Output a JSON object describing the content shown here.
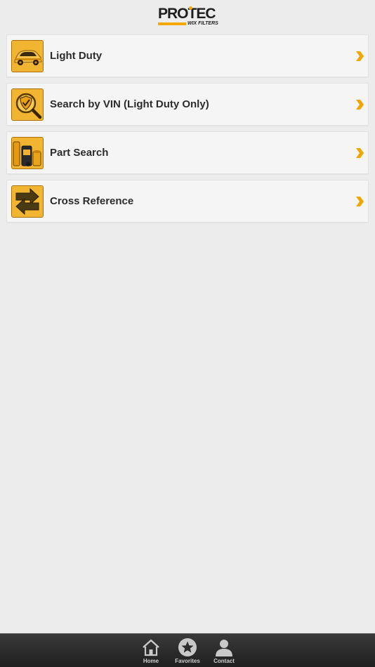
{
  "header": {
    "logo_main": "PROTEC",
    "logo_sub": "WIX FILTERS",
    "logo_accent": "#f5a800"
  },
  "menu": {
    "items": [
      {
        "label": "Light Duty",
        "icon": "car-icon"
      },
      {
        "label": "Search by VIN (Light Duty Only)",
        "icon": "shield-magnifier-icon"
      },
      {
        "label": "Part Search",
        "icon": "filter-parts-icon"
      },
      {
        "label": "Cross Reference",
        "icon": "swap-arrows-icon"
      }
    ],
    "chevron_color": "#f0a500"
  },
  "tabbar": {
    "tabs": [
      {
        "label": "Home",
        "icon": "home-icon"
      },
      {
        "label": "Favorites",
        "icon": "star-icon"
      },
      {
        "label": "Contact",
        "icon": "person-icon"
      }
    ]
  }
}
